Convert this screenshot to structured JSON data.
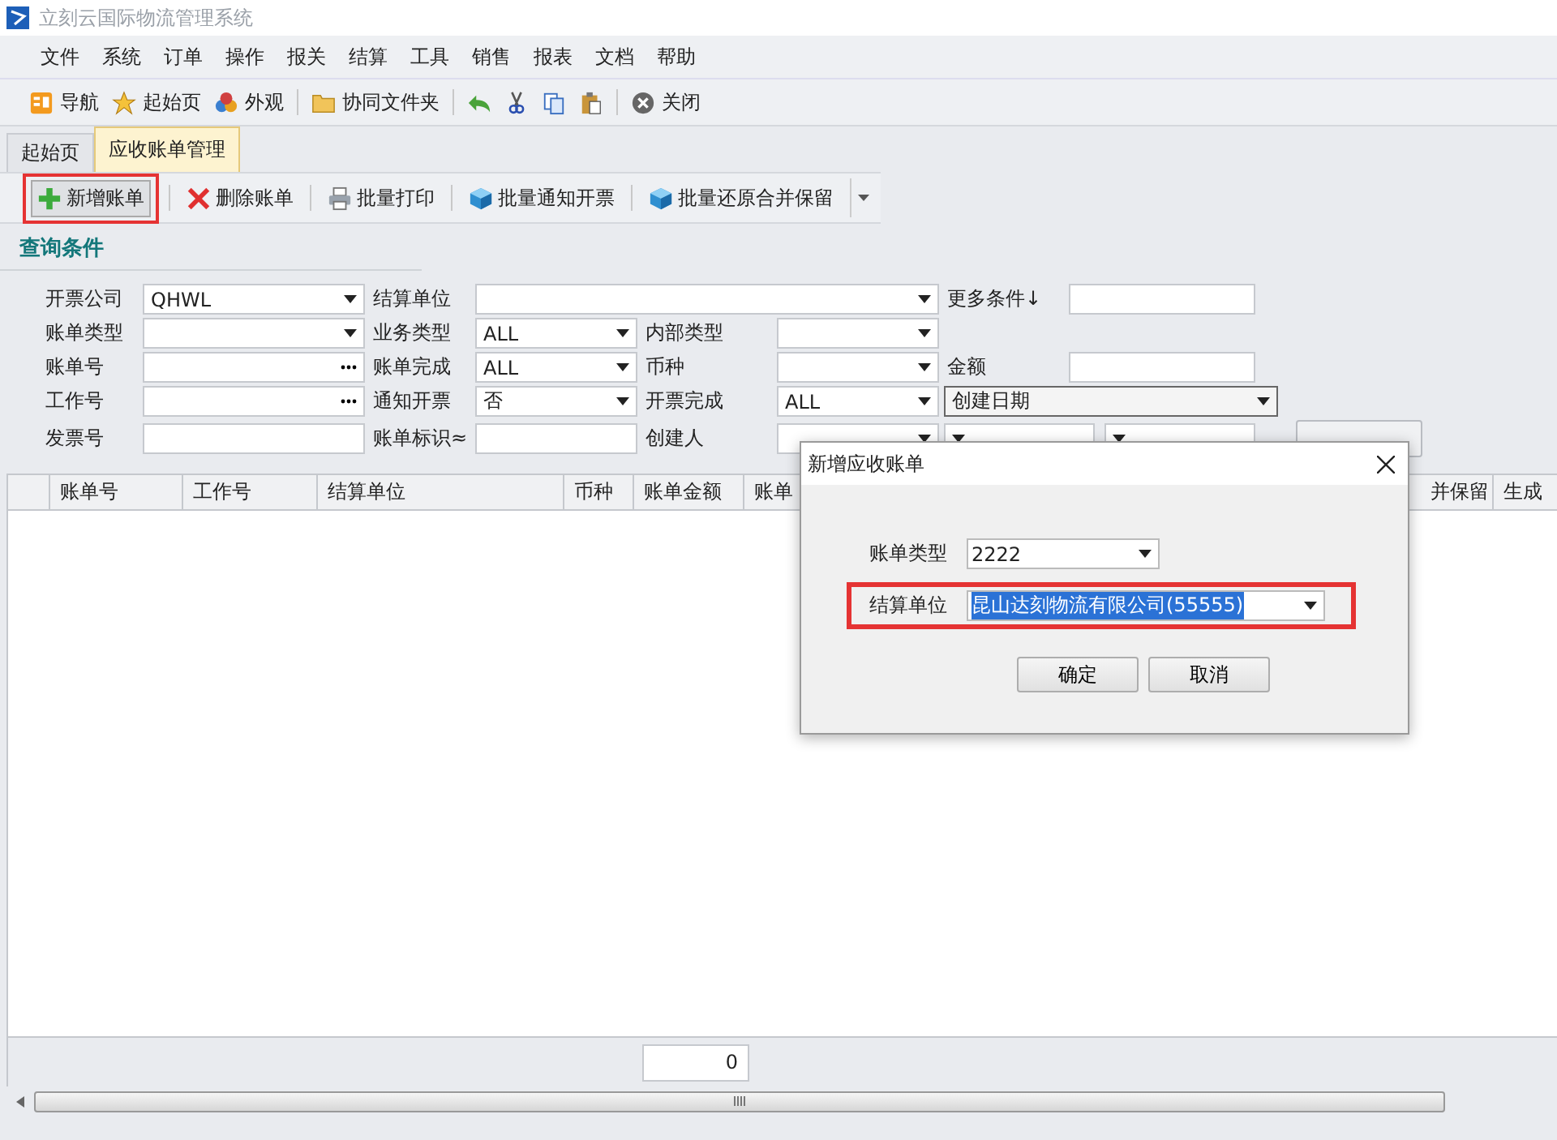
{
  "window": {
    "title": "立刻云国际物流管理系统"
  },
  "menu": [
    "文件",
    "系统",
    "订单",
    "操作",
    "报关",
    "结算",
    "工具",
    "销售",
    "报表",
    "文档",
    "帮助"
  ],
  "toolbar": [
    {
      "kind": "nav",
      "label": "导航"
    },
    {
      "kind": "star",
      "label": "起始页"
    },
    {
      "kind": "palette",
      "label": "外观"
    },
    {
      "kind": "sep"
    },
    {
      "kind": "folder",
      "label": "协同文件夹"
    },
    {
      "kind": "sep"
    },
    {
      "kind": "undo"
    },
    {
      "kind": "cut"
    },
    {
      "kind": "copy"
    },
    {
      "kind": "paste"
    },
    {
      "kind": "sep"
    },
    {
      "kind": "close",
      "label": "关闭"
    }
  ],
  "tabs": [
    {
      "label": "起始页",
      "selected": false
    },
    {
      "label": "应收账单管理",
      "selected": true
    }
  ],
  "actions": [
    {
      "kind": "add",
      "label": "新增账单",
      "highlighted": true
    },
    {
      "kind": "delete",
      "label": "删除账单",
      "highlighted": false
    },
    {
      "kind": "print",
      "label": "批量打印",
      "highlighted": false
    },
    {
      "kind": "cube",
      "label": "批量通知开票",
      "highlighted": false
    },
    {
      "kind": "cube",
      "label": "批量还原合并保留",
      "highlighted": false
    }
  ],
  "query": {
    "title": "查询条件",
    "rows": [
      [
        {
          "kind": "label",
          "text": "开票公司"
        },
        {
          "kind": "combo",
          "value": "QHWL"
        },
        {
          "kind": "label",
          "text": "结算单位"
        },
        {
          "kind": "combo-wide"
        },
        "",
        "",
        {
          "kind": "label",
          "text": "更多条件↓"
        },
        {
          "kind": "text"
        }
      ],
      [
        {
          "kind": "label",
          "text": "账单类型"
        },
        {
          "kind": "combo"
        },
        {
          "kind": "label",
          "text": "业务类型"
        },
        {
          "kind": "combo",
          "value": "ALL"
        },
        {
          "kind": "label",
          "text": "内部类型"
        },
        {
          "kind": "combo"
        }
      ],
      [
        {
          "kind": "label",
          "text": "账单号"
        },
        {
          "kind": "ellipsis"
        },
        {
          "kind": "label",
          "text": "账单完成"
        },
        {
          "kind": "combo",
          "value": "ALL"
        },
        {
          "kind": "label",
          "text": "币种"
        },
        {
          "kind": "combo"
        },
        {
          "kind": "label",
          "text": "金额"
        },
        {
          "kind": "text"
        }
      ],
      [
        {
          "kind": "label",
          "text": "工作号"
        },
        {
          "kind": "ellipsis"
        },
        {
          "kind": "label",
          "text": "通知开票"
        },
        {
          "kind": "combo",
          "value": "否"
        },
        {
          "kind": "label",
          "text": "开票完成"
        },
        {
          "kind": "combo",
          "value": "ALL"
        },
        {
          "kind": "combo-date",
          "value": "创建日期"
        },
        ""
      ],
      [
        {
          "kind": "label",
          "text": "发票号"
        },
        {
          "kind": "text"
        },
        {
          "kind": "label",
          "text": "账单标识≈"
        },
        {
          "kind": "text"
        },
        {
          "kind": "label",
          "text": "创建人"
        },
        {
          "kind": "combo"
        },
        {
          "kind": "range"
        },
        "",
        {
          "kind": "button"
        }
      ]
    ]
  },
  "table": {
    "columns": [
      {
        "label": "账单号"
      },
      {
        "label": "工作号"
      },
      {
        "label": "结算单位"
      },
      {
        "label": "币种"
      },
      {
        "label": "账单金额"
      },
      {
        "label": "账单"
      },
      {
        "label": "并保留"
      },
      {
        "label": "生成"
      }
    ],
    "total": "0"
  },
  "dialog": {
    "title": "新增应收账单",
    "fields": [
      {
        "label": "账单类型",
        "value": "2222",
        "highlighted": false,
        "selected_text": false
      },
      {
        "label": "结算单位",
        "value": "昆山达刻物流有限公司(55555)",
        "highlighted": true,
        "selected_text": true
      }
    ],
    "buttons": [
      "确定",
      "取消"
    ]
  }
}
